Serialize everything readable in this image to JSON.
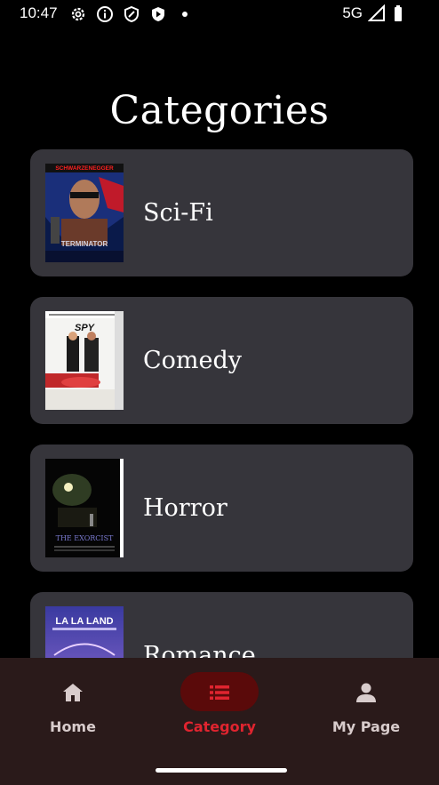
{
  "status": {
    "time": "10:47",
    "network": "5G"
  },
  "page": {
    "title": "Categories"
  },
  "categories": [
    {
      "label": "Sci-Fi",
      "poster": "terminator-poster",
      "poster_text": [
        "SCHWARZENEGGER",
        "TERMINATOR"
      ]
    },
    {
      "label": "Comedy",
      "poster": "spy-poster",
      "poster_text": [
        "SPY"
      ]
    },
    {
      "label": "Horror",
      "poster": "exorcist-poster",
      "poster_text": [
        "THE EXORCIST"
      ]
    },
    {
      "label": "Romance",
      "poster": "lalaland-poster",
      "poster_text": [
        "LA LA LAND"
      ]
    }
  ],
  "nav": {
    "items": [
      {
        "label": "Home",
        "icon": "home-icon",
        "active": false
      },
      {
        "label": "Category",
        "icon": "list-icon",
        "active": true
      },
      {
        "label": "My Page",
        "icon": "person-icon",
        "active": false
      }
    ]
  },
  "colors": {
    "background": "#000000",
    "card": "#36353b",
    "nav_background": "#2a1a1a",
    "accent": "#e0242f",
    "accent_pill": "#5a0a0a"
  }
}
